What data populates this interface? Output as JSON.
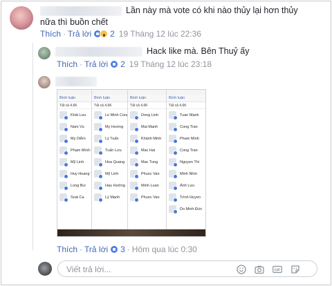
{
  "comment1": {
    "text": "Lần này mà vote có khi nào thủy lại hơn thủy nữa thì buồn chết",
    "like_label": "Thích",
    "reply_label": "Trả lời",
    "reaction_count": "2",
    "timestamp": "19 Tháng 12 lúc 22:36"
  },
  "reply1": {
    "text": "Hack like mà. Bên Thuỷ ấy",
    "like_label": "Thích",
    "reply_label": "Trả lời",
    "reaction_count": "2",
    "timestamp": "19 Tháng 12 lúc 23:18"
  },
  "reply2": {
    "like_label": "Thích",
    "reply_label": "Trả lời",
    "reaction_count": "3",
    "timestamp": "Hôm qua lúc 0:30",
    "screenshot": {
      "header": "Bình luận",
      "tab": "Tất cả 4,6K",
      "columns": [
        [
          "Khải Lưu",
          "Nam Vu",
          "My Diễm",
          "Phạm Minh P",
          "Mỹ Linh",
          "Huy Hoang T",
          "Long Bui",
          "Soái Ca"
        ],
        [
          "Le Minh Cong",
          "My Hương",
          "Lý Tuấn",
          "Tuấn Lưu",
          "Hoa Quang",
          "Mỹ Linh",
          "Hau Hường",
          "Lý Mạnh"
        ],
        [
          "Dong Linh",
          "Mai Manh",
          "Khánh Minh",
          "Mac Hai",
          "Mac Tung",
          "Phuoc Van",
          "Minh Luan",
          "Phuoc Van"
        ],
        [
          "Tuan Mạnh",
          "Cong Tran",
          "Pham Minh",
          "Cong Tran",
          "Nguyen Thi",
          "Minh Nhìn",
          "Ánh Lưu",
          "Trình Huyen",
          "Do Minh Đức"
        ]
      ]
    }
  },
  "reply_input": {
    "placeholder": "Viết trả lời..."
  },
  "icons": [
    "smile-icon",
    "camera-icon",
    "gif-icon",
    "sticker-icon"
  ],
  "colors": {
    "link": "#4267b2",
    "meta": "#90949c",
    "like_reaction": "#4e7de9",
    "haha_reaction": "#f7c647"
  }
}
